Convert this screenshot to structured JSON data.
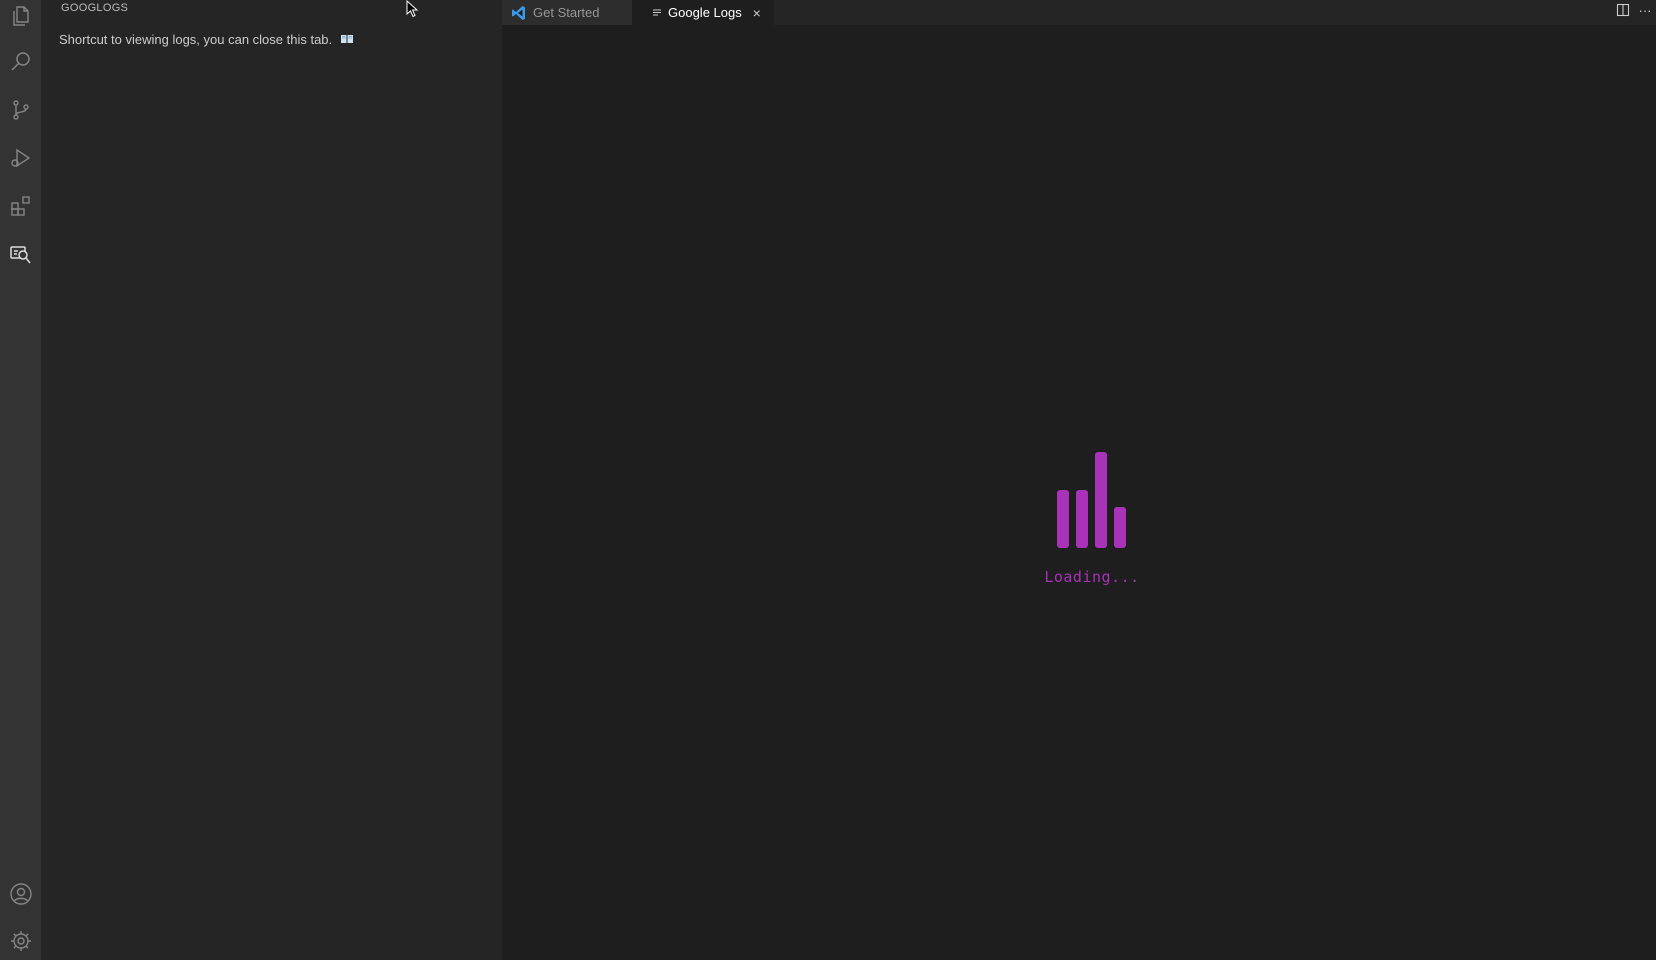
{
  "sidebar": {
    "title": "GOOGLOGS",
    "message": "Shortcut to viewing logs, you can close this tab."
  },
  "activity_bar": {
    "items": [
      {
        "icon": "files-icon"
      },
      {
        "icon": "search-icon"
      },
      {
        "icon": "source-control-icon"
      },
      {
        "icon": "run-debug-icon"
      },
      {
        "icon": "extensions-icon"
      },
      {
        "icon": "google-logs-icon",
        "active": true
      }
    ],
    "bottom": [
      {
        "icon": "account-icon"
      },
      {
        "icon": "settings-gear-icon"
      }
    ]
  },
  "tabs": [
    {
      "label": "Get Started",
      "icon": "vscode-icon",
      "active": false
    },
    {
      "label": "Google Logs",
      "icon": "document-icon",
      "active": true,
      "close": "×"
    }
  ],
  "editor_actions": [
    {
      "icon": "split-editor-icon"
    },
    {
      "icon": "more-actions-icon",
      "label": "···"
    }
  ],
  "loader": {
    "text": "Loading...",
    "color": "#a832b8"
  },
  "colors": {
    "activity_bar": "#333333",
    "sidebar": "#252526",
    "editor": "#1e1e1e",
    "accent": "#a832b8"
  }
}
